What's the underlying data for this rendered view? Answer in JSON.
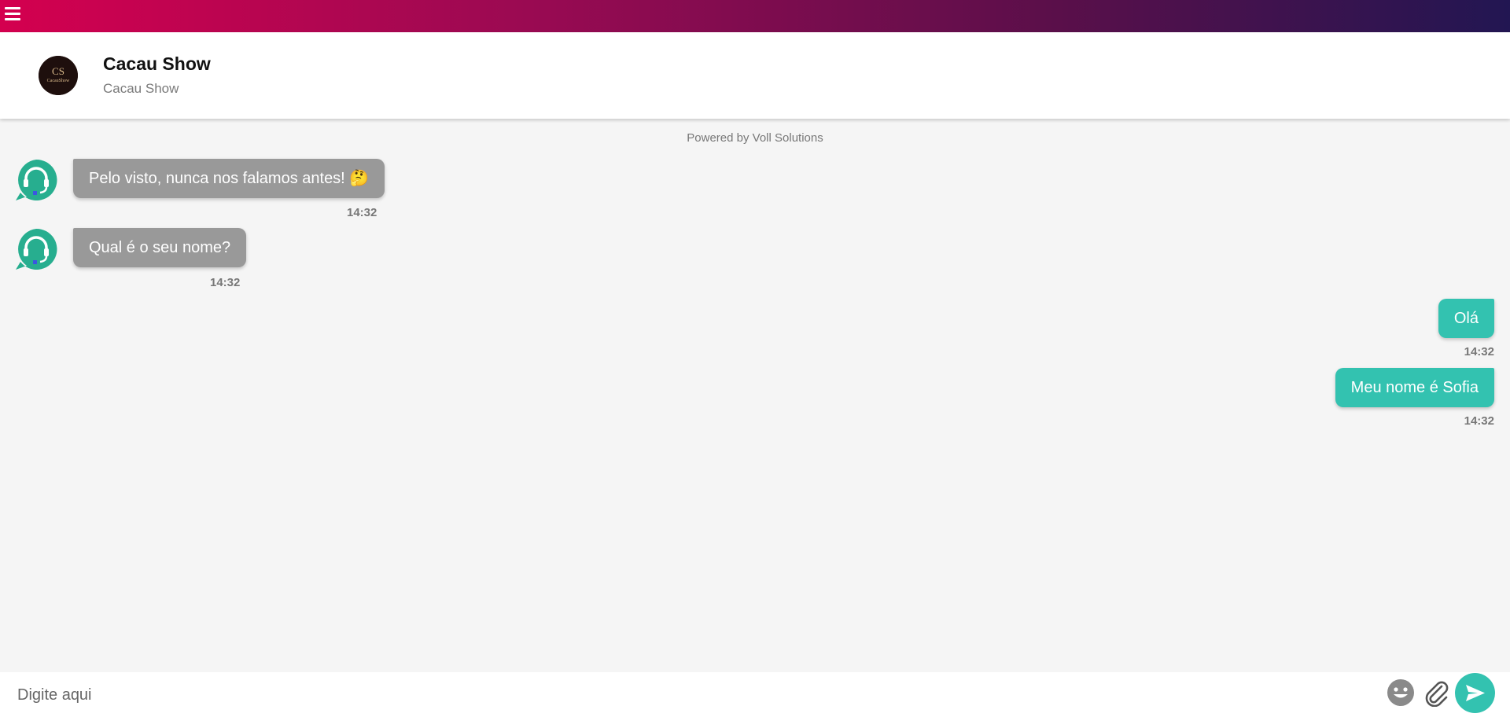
{
  "header": {
    "title": "Cacau Show",
    "subtitle": "Cacau Show",
    "logo_text": "CacauShow"
  },
  "powered_by": "Powered by Voll Solutions",
  "messages": [
    {
      "from": "bot",
      "text": "Pelo visto, nunca nos falamos antes! 🤔",
      "time": "14:32"
    },
    {
      "from": "bot",
      "text": "Qual é o seu nome?",
      "time": "14:32"
    },
    {
      "from": "user",
      "text": "Olá",
      "time": "14:32"
    },
    {
      "from": "user",
      "text": "Meu nome é Sofia",
      "time": "14:32"
    }
  ],
  "composer": {
    "placeholder": "Digite aqui"
  },
  "icons": {
    "menu": "hamburger-icon",
    "emoji": "emoji-icon",
    "attach": "paperclip-icon",
    "send": "send-icon",
    "agent": "headset-chat-icon"
  },
  "colors": {
    "gradient_start": "#d4004f",
    "gradient_end": "#221652",
    "accent": "#33c2b0",
    "bot_bubble": "#999999"
  }
}
